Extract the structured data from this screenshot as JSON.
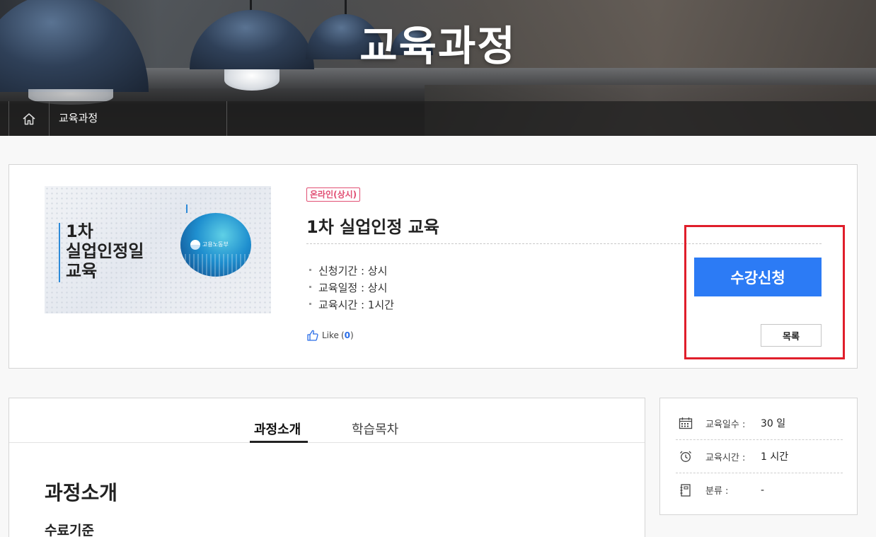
{
  "hero": {
    "title": "교육과정"
  },
  "breadcrumb": {
    "home_icon": "home-icon",
    "current": "교육과정"
  },
  "course": {
    "thumbnail": {
      "lines": [
        "1차",
        "실업인정일",
        "교육"
      ],
      "logo_text": "고용노동부"
    },
    "badge": "온라인(상시)",
    "title": "1차 실업인정 교육",
    "info": [
      {
        "label": "신청기간",
        "value": "상시"
      },
      {
        "label": "교육일정",
        "value": "상시"
      },
      {
        "label": "교육시간",
        "value": "1시간"
      }
    ],
    "like": {
      "label": "Like",
      "count": "0",
      "icon": "thumbs-up-icon"
    },
    "apply_label": "수강신청",
    "list_label": "목록"
  },
  "tabs": [
    {
      "label": "과정소개",
      "active": true
    },
    {
      "label": "학습목차",
      "active": false
    }
  ],
  "content": {
    "section_title": "과정소개",
    "subsection_title": "수료기준"
  },
  "side_info": [
    {
      "icon": "calendar-icon",
      "label": "교육일수 :",
      "value": "30 일"
    },
    {
      "icon": "alarm-clock-icon",
      "label": "교육시간 :",
      "value": "1 시간"
    },
    {
      "icon": "notebook-icon",
      "label": "분류 :",
      "value": "-"
    }
  ],
  "colors": {
    "accent_blue": "#2c7bf5",
    "badge_pink": "#e14f73",
    "highlight_red": "#e01e2b"
  }
}
